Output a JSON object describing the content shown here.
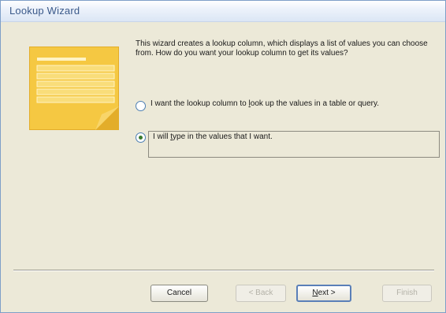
{
  "window": {
    "title": "Lookup Wizard"
  },
  "illustration": {
    "icon": "lookup-list-icon"
  },
  "main": {
    "prompt": "This wizard creates a lookup column, which displays a list of values you can choose from. How do you want your lookup column to get its values?",
    "options": [
      {
        "label_before": "I want the lookup column to ",
        "label_key": "l",
        "label_after": "ook up the values in a table or query.",
        "selected": false
      },
      {
        "label_before": "I will ",
        "label_key": "t",
        "label_after": "ype in the values that I want.",
        "selected": true
      }
    ]
  },
  "buttons": {
    "cancel": "Cancel",
    "back": "< Back",
    "next_key": "N",
    "next_rest": "ext >",
    "finish": "Finish"
  },
  "colors": {
    "dialog_bg": "#ece9d8",
    "title_text": "#3b5a8a",
    "note_yellow": "#f5c842",
    "radio_selected": "#3a7a2e"
  }
}
